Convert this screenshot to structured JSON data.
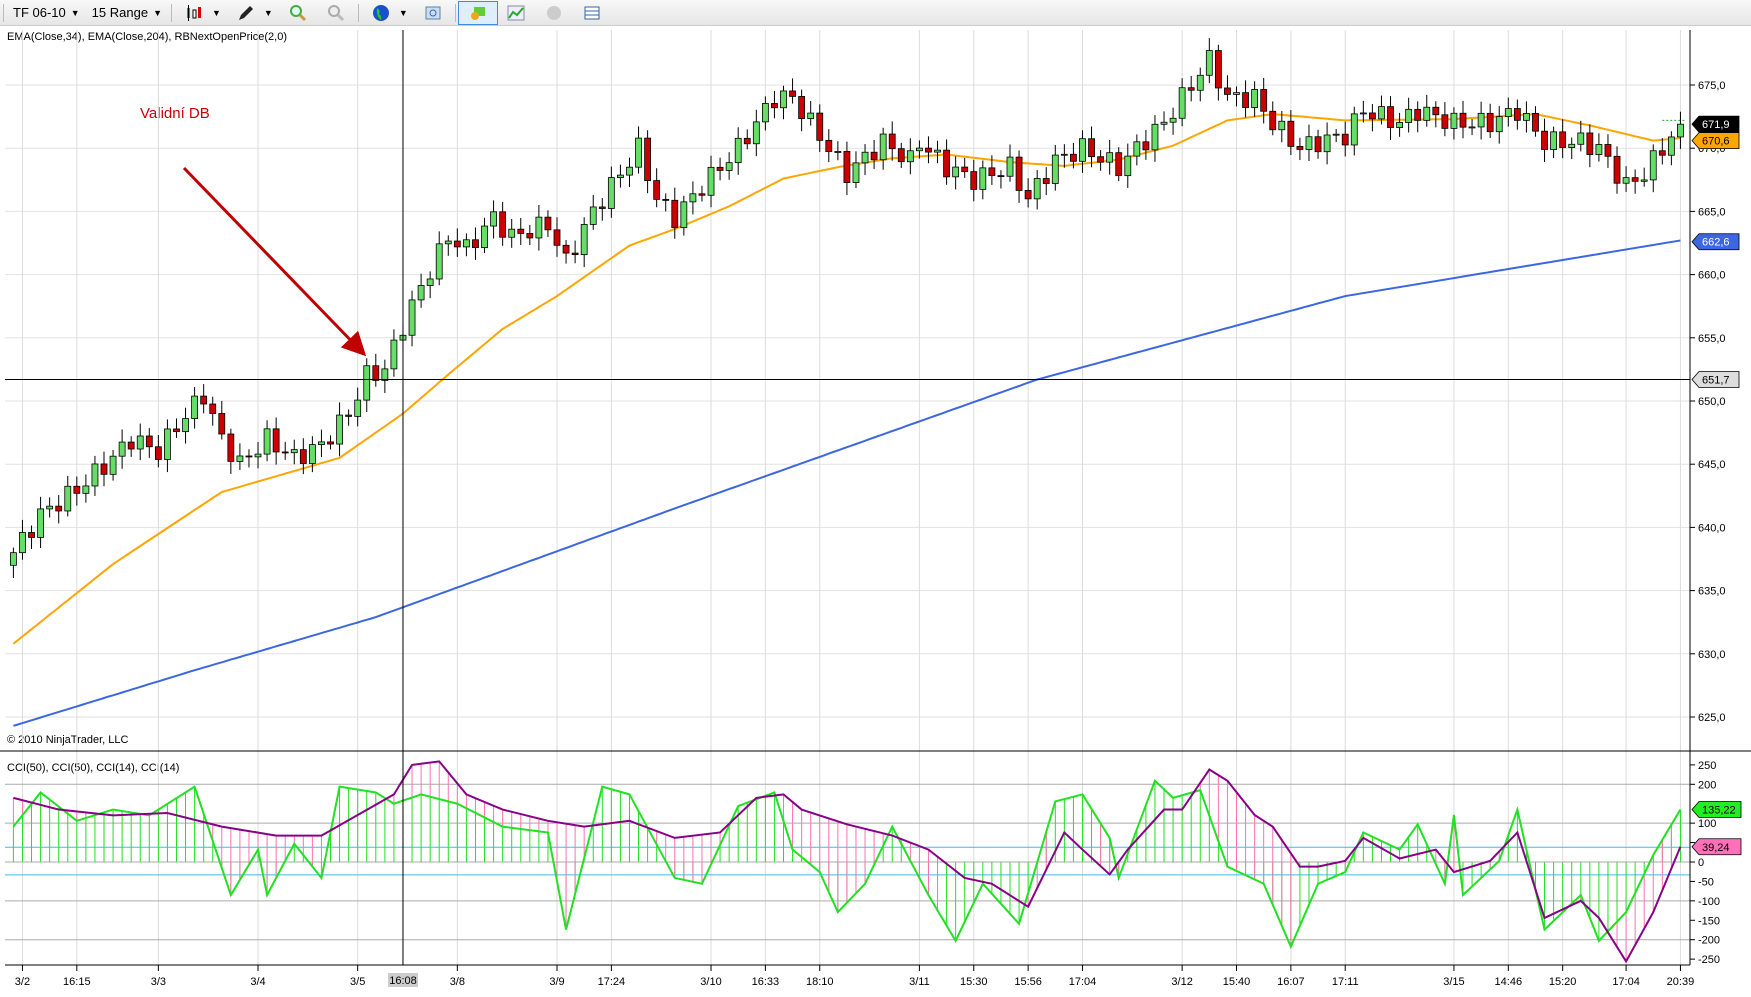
{
  "toolbar": {
    "instrument": "TF 06-10",
    "period": "15 Range",
    "icons": [
      "candlestick-chart-icon",
      "draw-pen-icon",
      "zoom-in-icon",
      "zoom-out-icon",
      "globe-icon",
      "properties-icon",
      "trade-icon",
      "indicator-icon",
      "strategy-icon",
      "data-box-icon"
    ]
  },
  "price_panel": {
    "indicator_label": "EMA(Close,34), EMA(Close,204), RBNextOpenPrice(2,0)",
    "copyright": "© 2010 NinjaTrader, LLC",
    "annotation": "Validní DB",
    "colors": {
      "up": "#66dd66",
      "down": "#cc0000",
      "ema34": "#ffa500",
      "ema204": "#3d67e0",
      "annotation": "#cc0000"
    }
  },
  "cci_panel": {
    "indicator_label": "CCI(50), CCI(50), CCI(14), CCI(14)",
    "colors": {
      "cci14": "#22e022",
      "cci50": "#880088",
      "hist_up": "#22e022",
      "hist_pink": "#ff70b8",
      "level": "#33c0e8"
    }
  },
  "chart_data": {
    "type": "candlestick",
    "bars": 185,
    "price_ylim": [
      622,
      678
    ],
    "price_ticks": [
      "675,0",
      "670,0",
      "665,0",
      "660,0",
      "655,0",
      "650,0",
      "645,0",
      "640,0",
      "635,0",
      "630,0",
      "625,0"
    ],
    "price_tick_values": [
      675,
      670,
      665,
      660,
      655,
      650,
      645,
      640,
      635,
      630,
      625
    ],
    "close_waypoints": [
      [
        0,
        638
      ],
      [
        3,
        641
      ],
      [
        7,
        643
      ],
      [
        11,
        645.5
      ],
      [
        13,
        647
      ],
      [
        16,
        646
      ],
      [
        18,
        648
      ],
      [
        21,
        650.5
      ],
      [
        23,
        647
      ],
      [
        25,
        645
      ],
      [
        28,
        647
      ],
      [
        31,
        645.5
      ],
      [
        34,
        646.5
      ],
      [
        37,
        649
      ],
      [
        39,
        652
      ],
      [
        41,
        652.5
      ],
      [
        43,
        656
      ],
      [
        45,
        659
      ],
      [
        48,
        663
      ],
      [
        50,
        662
      ],
      [
        53,
        664.5
      ],
      [
        55,
        663
      ],
      [
        59,
        664
      ],
      [
        61,
        661
      ],
      [
        64,
        665
      ],
      [
        66,
        667
      ],
      [
        69,
        670
      ],
      [
        71,
        666
      ],
      [
        73,
        664.5
      ],
      [
        76,
        667
      ],
      [
        80,
        670
      ],
      [
        84,
        674
      ],
      [
        86,
        674
      ],
      [
        90,
        670
      ],
      [
        92,
        668
      ],
      [
        96,
        670.5
      ],
      [
        99,
        669
      ],
      [
        100,
        670.5
      ],
      [
        103,
        668.5
      ],
      [
        106,
        667.5
      ],
      [
        110,
        668.5
      ],
      [
        112,
        666
      ],
      [
        115,
        669
      ],
      [
        118,
        670
      ],
      [
        122,
        668.5
      ],
      [
        124,
        670
      ],
      [
        127,
        672
      ],
      [
        129,
        674
      ],
      [
        132,
        677
      ],
      [
        134,
        674
      ],
      [
        137,
        674
      ],
      [
        139,
        672
      ],
      [
        142,
        670
      ],
      [
        144,
        670.5
      ],
      [
        147,
        671
      ],
      [
        149,
        673
      ],
      [
        153,
        672
      ],
      [
        155,
        673
      ],
      [
        159,
        672
      ],
      [
        163,
        672
      ],
      [
        166,
        673
      ],
      [
        169,
        670.5
      ],
      [
        173,
        670.5
      ],
      [
        175,
        670
      ],
      [
        178,
        667
      ],
      [
        180,
        668
      ],
      [
        182,
        670
      ],
      [
        184,
        671.9
      ]
    ],
    "ema34": [
      [
        0,
        630.8
      ],
      [
        11,
        637.1
      ],
      [
        23,
        642.8
      ],
      [
        36,
        645.5
      ],
      [
        43,
        649
      ],
      [
        48,
        652.1
      ],
      [
        54,
        655.7
      ],
      [
        60,
        658.3
      ],
      [
        68,
        662.3
      ],
      [
        73,
        663.6
      ],
      [
        79,
        665.4
      ],
      [
        85,
        667.6
      ],
      [
        91,
        668.5
      ],
      [
        97,
        669.2
      ],
      [
        103,
        669.5
      ],
      [
        110,
        668.9
      ],
      [
        116,
        668.6
      ],
      [
        122,
        669.1
      ],
      [
        128,
        670.2
      ],
      [
        134,
        672.2
      ],
      [
        139,
        672.7
      ],
      [
        147,
        672.2
      ],
      [
        159,
        672.3
      ],
      [
        168,
        672.7
      ],
      [
        174,
        671.8
      ],
      [
        181,
        670.6
      ],
      [
        184,
        670.8
      ]
    ],
    "ema204": [
      [
        0,
        624.3
      ],
      [
        20,
        628.7
      ],
      [
        40,
        632.9
      ],
      [
        73,
        641.5
      ],
      [
        113,
        651.7
      ],
      [
        147,
        658.3
      ],
      [
        184,
        662.7
      ]
    ],
    "last_values": {
      "close": "671,9",
      "ema34": "670,6",
      "ema204": "662,6",
      "crosshair_price": "651,7"
    },
    "crosshair": {
      "bar": 43,
      "price": 651.7,
      "time_label": "16:08"
    },
    "x_labels": [
      [
        1,
        "3/2"
      ],
      [
        7,
        "16:15"
      ],
      [
        16,
        "3/3"
      ],
      [
        27,
        "3/4"
      ],
      [
        38,
        "3/5"
      ],
      [
        49,
        "3/8"
      ],
      [
        60,
        "3/9"
      ],
      [
        66,
        "17:24"
      ],
      [
        77,
        "3/10"
      ],
      [
        83,
        "16:33"
      ],
      [
        89,
        "18:10"
      ],
      [
        100,
        "3/11"
      ],
      [
        106,
        "15:30"
      ],
      [
        112,
        "15:56"
      ],
      [
        118,
        "17:04"
      ],
      [
        129,
        "3/12"
      ],
      [
        135,
        "15:40"
      ],
      [
        141,
        "16:07"
      ],
      [
        147,
        "17:11"
      ],
      [
        159,
        "3/15"
      ],
      [
        165,
        "14:46"
      ],
      [
        171,
        "15:20"
      ],
      [
        178,
        "17:04"
      ],
      [
        184,
        "20:39"
      ]
    ],
    "cci_ylim": [
      -270,
      270
    ],
    "cci_ticks": [
      "250",
      "200",
      "100",
      "50",
      "0",
      "-50",
      "-100",
      "-150",
      "-200",
      "-250"
    ],
    "cci_tick_values": [
      250,
      200,
      100,
      50,
      0,
      -50,
      -100,
      -150,
      -200,
      -250
    ],
    "cci_grid": [
      200,
      100,
      0,
      -100,
      -200
    ],
    "cci_levels": [
      38,
      -33
    ],
    "cci50": [
      [
        0,
        165
      ],
      [
        5,
        135
      ],
      [
        11,
        120
      ],
      [
        17,
        126
      ],
      [
        23,
        91
      ],
      [
        29,
        68
      ],
      [
        34,
        68
      ],
      [
        38,
        121
      ],
      [
        42,
        174
      ],
      [
        44,
        250
      ],
      [
        47,
        259
      ],
      [
        50,
        174
      ],
      [
        54,
        135
      ],
      [
        59,
        106
      ],
      [
        63,
        91
      ],
      [
        68,
        106
      ],
      [
        73,
        62
      ],
      [
        78,
        76
      ],
      [
        82,
        165
      ],
      [
        85,
        174
      ],
      [
        87,
        135
      ],
      [
        92,
        97
      ],
      [
        97,
        68
      ],
      [
        101,
        32
      ],
      [
        105,
        -41
      ],
      [
        108,
        -56
      ],
      [
        112,
        -115
      ],
      [
        116,
        76
      ],
      [
        118,
        32
      ],
      [
        121,
        -32
      ],
      [
        123,
        32
      ],
      [
        127,
        135
      ],
      [
        129,
        135
      ],
      [
        132,
        238
      ],
      [
        134,
        209
      ],
      [
        137,
        121
      ],
      [
        139,
        91
      ],
      [
        142,
        -12
      ],
      [
        144,
        -12
      ],
      [
        147,
        3
      ],
      [
        149,
        62
      ],
      [
        153,
        9
      ],
      [
        157,
        32
      ],
      [
        159,
        -26
      ],
      [
        163,
        3
      ],
      [
        166,
        76
      ],
      [
        169,
        -144
      ],
      [
        173,
        -100
      ],
      [
        175,
        -144
      ],
      [
        178,
        -256
      ],
      [
        181,
        -129
      ],
      [
        184,
        39.24
      ]
    ],
    "cci14": [
      [
        0,
        91
      ],
      [
        3,
        179
      ],
      [
        7,
        106
      ],
      [
        11,
        135
      ],
      [
        15,
        120
      ],
      [
        20,
        194
      ],
      [
        24,
        -85
      ],
      [
        27,
        32
      ],
      [
        28,
        -85
      ],
      [
        31,
        47
      ],
      [
        34,
        -41
      ],
      [
        36,
        194
      ],
      [
        40,
        179
      ],
      [
        42,
        150
      ],
      [
        45,
        174
      ],
      [
        49,
        150
      ],
      [
        54,
        91
      ],
      [
        59,
        76
      ],
      [
        61,
        -174
      ],
      [
        65,
        194
      ],
      [
        68,
        174
      ],
      [
        73,
        -41
      ],
      [
        76,
        -56
      ],
      [
        80,
        144
      ],
      [
        84,
        179
      ],
      [
        86,
        32
      ],
      [
        89,
        -26
      ],
      [
        91,
        -129
      ],
      [
        94,
        -56
      ],
      [
        97,
        91
      ],
      [
        101,
        -85
      ],
      [
        104,
        -203
      ],
      [
        107,
        -56
      ],
      [
        111,
        -159
      ],
      [
        115,
        156
      ],
      [
        118,
        174
      ],
      [
        121,
        62
      ],
      [
        122,
        -41
      ],
      [
        126,
        209
      ],
      [
        128,
        165
      ],
      [
        131,
        185
      ],
      [
        134,
        -12
      ],
      [
        138,
        -56
      ],
      [
        141,
        -218
      ],
      [
        144,
        -56
      ],
      [
        147,
        -26
      ],
      [
        149,
        76
      ],
      [
        153,
        32
      ],
      [
        155,
        97
      ],
      [
        158,
        -56
      ],
      [
        159,
        121
      ],
      [
        160,
        -85
      ],
      [
        164,
        3
      ],
      [
        166,
        135
      ],
      [
        169,
        -174
      ],
      [
        173,
        -85
      ],
      [
        175,
        -203
      ],
      [
        178,
        -129
      ],
      [
        181,
        18
      ],
      [
        184,
        135.22
      ]
    ],
    "cci_last": {
      "cci14": "135,22",
      "cci50": "39,24"
    }
  }
}
